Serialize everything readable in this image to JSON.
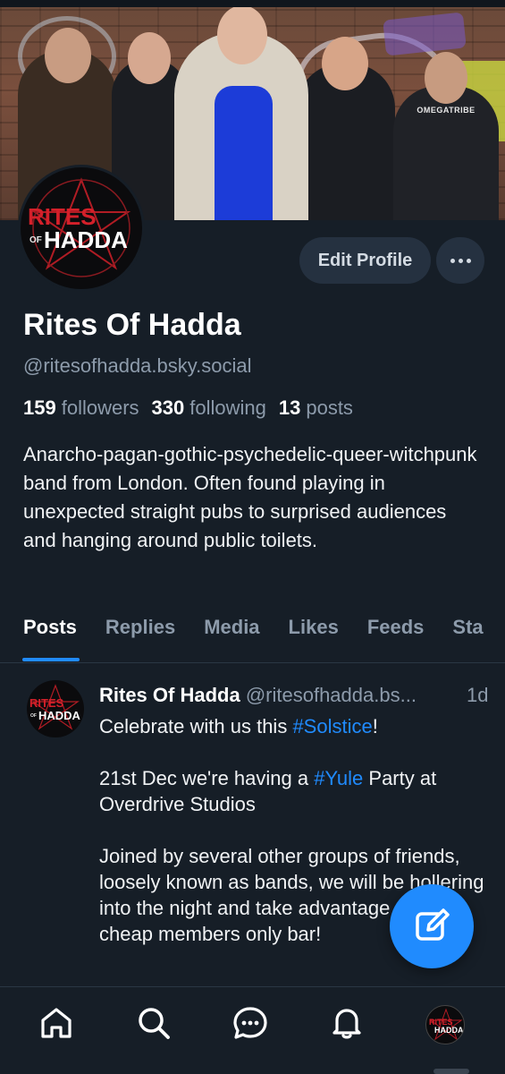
{
  "profile": {
    "display_name": "Rites Of Hadda",
    "handle": "@ritesofhadda.bsky.social",
    "bio": "Anarcho-pagan-gothic-psychedelic-queer-witchpunk band from London. Often found playing in unexpected straight pubs to surprised audiences and hanging around public toilets.",
    "logo_text_top": "RITES",
    "logo_text_of": "OF",
    "logo_text_bottom": "HADDA",
    "banner_shirt_text": "OMEGATRIBE"
  },
  "stats": {
    "followers_count": "159",
    "followers_label": "followers",
    "following_count": "330",
    "following_label": "following",
    "posts_count": "13",
    "posts_label": "posts"
  },
  "actions": {
    "edit_profile_label": "Edit Profile",
    "more_icon": "ellipsis-icon"
  },
  "tabs": [
    {
      "label": "Posts",
      "active": true
    },
    {
      "label": "Replies"
    },
    {
      "label": "Media"
    },
    {
      "label": "Likes"
    },
    {
      "label": "Feeds"
    },
    {
      "label": "Sta"
    }
  ],
  "post": {
    "author_name": "Rites Of Hadda",
    "author_handle": "@ritesofhadda.bs...",
    "time": "1d",
    "line1_prefix": "Celebrate with us this ",
    "line1_tag": "#Solstice",
    "line1_suffix": "!",
    "line2_prefix": "21st Dec we're having a ",
    "line2_tag": "#Yule",
    "line2_suffix": " Party at Overdrive Studios",
    "line3": "Joined by several other groups of friends, loosely known as bands, we will be hollering into the night and take advantage of the cheap members only bar!"
  },
  "colors": {
    "background": "#161e27",
    "accent": "#208bfe",
    "muted": "#8d9bab",
    "button_bg": "#253140",
    "logo_red": "#d4202a"
  },
  "bottom_nav": [
    {
      "name": "home",
      "icon": "home-icon"
    },
    {
      "name": "search",
      "icon": "search-icon"
    },
    {
      "name": "chat",
      "icon": "chat-icon"
    },
    {
      "name": "notifications",
      "icon": "bell-icon"
    },
    {
      "name": "profile",
      "icon": "avatar"
    }
  ],
  "fab": {
    "icon": "compose-icon"
  }
}
